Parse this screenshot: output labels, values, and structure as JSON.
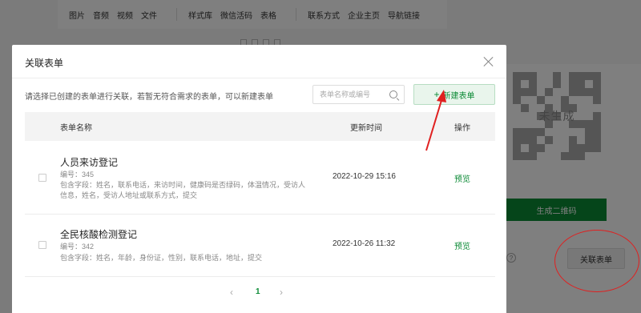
{
  "background": {
    "toolbar_groups": [
      [
        "图片",
        "音频",
        "视频",
        "文件"
      ],
      [
        "样式库",
        "微信活码",
        "表格"
      ],
      [
        "联系方式",
        "企业主页",
        "导航链接"
      ]
    ],
    "qr_status": "未生成",
    "generate_qr_label": "生成二维码",
    "help_glyph": "?",
    "link_form_label": "关联表单"
  },
  "modal": {
    "title": "关联表单",
    "description": "请选择已创建的表单进行关联，若暂无符合需求的表单，可以新建表单",
    "search_placeholder": "表单名称或编号",
    "new_form_label": "新建表单",
    "columns": {
      "name": "表单名称",
      "time": "更新时间",
      "op": "操作"
    },
    "rows": [
      {
        "name": "人员来访登记",
        "id": "编号：345",
        "fields": "包含字段：姓名，联系电话，来访时间，健康码是否绿码，体温情况，受访人信息，姓名，受访人地址或联系方式，提交",
        "time": "2022-10-29 15:16",
        "op": "预览"
      },
      {
        "name": "全民核酸检测登记",
        "id": "编号：342",
        "fields": "包含字段：姓名，年龄，身份证，性别，联系电话，地址，提交",
        "time": "2022-10-26 11:32",
        "op": "预览"
      }
    ],
    "pager": {
      "prev": "‹",
      "current": "1",
      "next": "›"
    }
  },
  "colors": {
    "accent": "#0b8a35",
    "annotation": "#e02020"
  },
  "icons": {
    "close": "close-icon",
    "search": "search-icon",
    "plus": "plus-icon"
  }
}
